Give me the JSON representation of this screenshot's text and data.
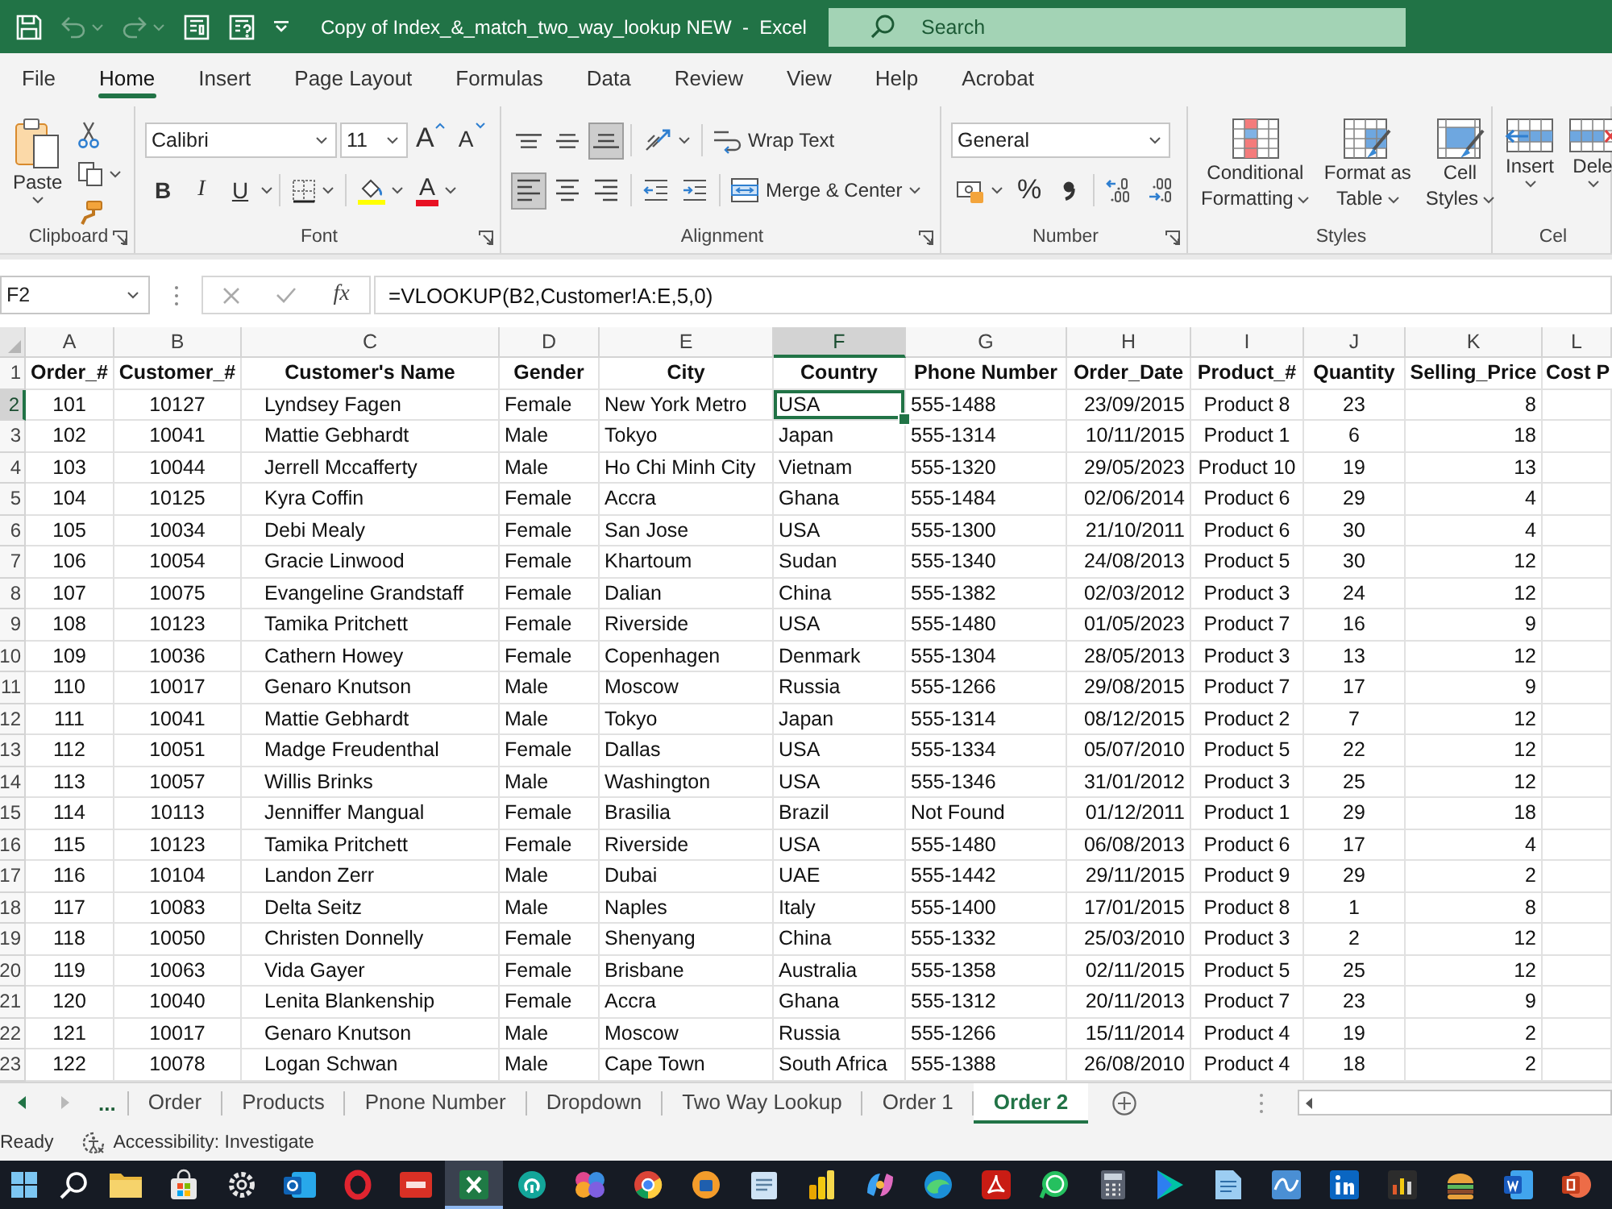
{
  "title_bar": {
    "quick_access": [
      {
        "kind": "save",
        "disabled": false
      },
      {
        "kind": "undo",
        "disabled": true
      },
      {
        "kind": "redo",
        "disabled": true
      },
      {
        "kind": "form",
        "disabled": false
      },
      {
        "kind": "form_help",
        "disabled": false
      },
      {
        "kind": "customize",
        "disabled": false
      }
    ],
    "title": "Copy of Index_&_match_two_way_lookup NEW  -  Excel",
    "search": {
      "placeholder": "Search"
    }
  },
  "menu_tabs": [
    {
      "label": "File",
      "selected": false
    },
    {
      "label": "Home",
      "selected": true
    },
    {
      "label": "Insert",
      "selected": false
    },
    {
      "label": "Page Layout",
      "selected": false
    },
    {
      "label": "Formulas",
      "selected": false
    },
    {
      "label": "Data",
      "selected": false
    },
    {
      "label": "Review",
      "selected": false
    },
    {
      "label": "View",
      "selected": false
    },
    {
      "label": "Help",
      "selected": false
    },
    {
      "label": "Acrobat",
      "selected": false
    }
  ],
  "ribbon": {
    "clipboard": {
      "paste_label": "Paste",
      "group_label": "Clipboard"
    },
    "font": {
      "name": "Calibri",
      "size": "11",
      "grow_label": "A",
      "shrink_label": "A",
      "styles": [
        {
          "kind": "bold",
          "label": "B"
        },
        {
          "kind": "italic",
          "label": "I"
        },
        {
          "kind": "underline",
          "label": "U"
        }
      ],
      "color_label": "A",
      "group_label": "Font"
    },
    "alignment": {
      "vertical": [
        {
          "kind": "top",
          "selected": false
        },
        {
          "kind": "middle",
          "selected": false
        },
        {
          "kind": "bottom",
          "selected": true
        }
      ],
      "horizontal": [
        {
          "kind": "left",
          "selected": true
        },
        {
          "kind": "center",
          "selected": false
        },
        {
          "kind": "right",
          "selected": false
        }
      ],
      "wrap_label": "Wrap Text",
      "merge_label": "Merge & Center",
      "group_label": "Alignment"
    },
    "number": {
      "format": "General",
      "percent_label": "%",
      "group_label": "Number"
    },
    "styles": {
      "buttons": [
        {
          "kind": "conditional",
          "lines": [
            "Conditional",
            "Formatting"
          ]
        },
        {
          "kind": "table",
          "lines": [
            "Format as",
            "Table"
          ]
        },
        {
          "kind": "cell",
          "lines": [
            "Cell",
            "Styles"
          ]
        }
      ],
      "group_label": "Styles"
    },
    "cells": {
      "buttons": [
        {
          "kind": "insert",
          "label": "Insert"
        },
        {
          "kind": "delete",
          "label": "Dele"
        }
      ],
      "group_label": "Cel"
    }
  },
  "formula_bar": {
    "name_box": "F2",
    "function_label": "fx",
    "formula": "=VLOOKUP(B2,Customer!A:E,5,0)"
  },
  "sheet": {
    "columns": [
      {
        "letter": "A",
        "heading": "Order_#",
        "selected": false
      },
      {
        "letter": "B",
        "heading": "Customer_#",
        "selected": false
      },
      {
        "letter": "C",
        "heading": "Customer's Name",
        "selected": false
      },
      {
        "letter": "D",
        "heading": "Gender",
        "selected": false
      },
      {
        "letter": "E",
        "heading": "City",
        "selected": false
      },
      {
        "letter": "F",
        "heading": "Country",
        "selected": true
      },
      {
        "letter": "G",
        "heading": "Phone Number",
        "selected": false
      },
      {
        "letter": "H",
        "heading": "Order_Date",
        "selected": false
      },
      {
        "letter": "I",
        "heading": "Product_#",
        "selected": false
      },
      {
        "letter": "J",
        "heading": "Quantity",
        "selected": false
      },
      {
        "letter": "K",
        "heading": "Selling_Price",
        "selected": false
      },
      {
        "letter": "L",
        "heading": "Cost P",
        "selected": false
      }
    ],
    "header_row": {
      "number": "1",
      "selected": false
    },
    "rows": [
      {
        "number": "2",
        "selected": true,
        "cells": [
          "101",
          "10127",
          "Lyndsey Fagen",
          "Female",
          "New York Metro",
          "USA",
          "555-1488",
          "23/09/2015",
          "Product 8",
          "23",
          "8"
        ]
      },
      {
        "number": "3",
        "selected": false,
        "cells": [
          "102",
          "10041",
          "Mattie Gebhardt",
          "Male",
          "Tokyo",
          "Japan",
          "555-1314",
          "10/11/2015",
          "Product 1",
          "6",
          "18"
        ]
      },
      {
        "number": "4",
        "selected": false,
        "cells": [
          "103",
          "10044",
          "Jerrell Mccafferty",
          "Male",
          "Ho Chi Minh City",
          "Vietnam",
          "555-1320",
          "29/05/2023",
          "Product 10",
          "19",
          "13"
        ]
      },
      {
        "number": "5",
        "selected": false,
        "cells": [
          "104",
          "10125",
          "Kyra Coffin",
          "Female",
          "Accra",
          "Ghana",
          "555-1484",
          "02/06/2014",
          "Product 6",
          "29",
          "4"
        ]
      },
      {
        "number": "6",
        "selected": false,
        "cells": [
          "105",
          "10034",
          "Debi Mealy",
          "Female",
          "San Jose",
          "USA",
          "555-1300",
          "21/10/2011",
          "Product 6",
          "30",
          "4"
        ]
      },
      {
        "number": "7",
        "selected": false,
        "cells": [
          "106",
          "10054",
          "Gracie Linwood",
          "Female",
          "Khartoum",
          "Sudan",
          "555-1340",
          "24/08/2013",
          "Product 5",
          "30",
          "12"
        ]
      },
      {
        "number": "8",
        "selected": false,
        "cells": [
          "107",
          "10075",
          "Evangeline Grandstaff",
          "Female",
          "Dalian",
          "China",
          "555-1382",
          "02/03/2012",
          "Product 3",
          "24",
          "12"
        ]
      },
      {
        "number": "9",
        "selected": false,
        "cells": [
          "108",
          "10123",
          "Tamika Pritchett",
          "Female",
          "Riverside",
          "USA",
          "555-1480",
          "01/05/2023",
          "Product 7",
          "16",
          "9"
        ]
      },
      {
        "number": "10",
        "selected": false,
        "cells": [
          "109",
          "10036",
          "Cathern Howey",
          "Female",
          "Copenhagen",
          "Denmark",
          "555-1304",
          "28/05/2013",
          "Product 3",
          "13",
          "12"
        ]
      },
      {
        "number": "11",
        "selected": false,
        "cells": [
          "110",
          "10017",
          "Genaro Knutson",
          "Male",
          "Moscow",
          "Russia",
          "555-1266",
          "29/08/2015",
          "Product 7",
          "17",
          "9"
        ]
      },
      {
        "number": "12",
        "selected": false,
        "cells": [
          "111",
          "10041",
          "Mattie Gebhardt",
          "Male",
          "Tokyo",
          "Japan",
          "555-1314",
          "08/12/2015",
          "Product 2",
          "7",
          "12"
        ]
      },
      {
        "number": "13",
        "selected": false,
        "cells": [
          "112",
          "10051",
          "Madge Freudenthal",
          "Female",
          "Dallas",
          "USA",
          "555-1334",
          "05/07/2010",
          "Product 5",
          "22",
          "12"
        ]
      },
      {
        "number": "14",
        "selected": false,
        "cells": [
          "113",
          "10057",
          "Willis Brinks",
          "Male",
          "Washington",
          "USA",
          "555-1346",
          "31/01/2012",
          "Product 3",
          "25",
          "12"
        ]
      },
      {
        "number": "15",
        "selected": false,
        "cells": [
          "114",
          "10113",
          "Jenniffer Mangual",
          "Female",
          "Brasilia",
          "Brazil",
          "Not Found",
          "01/12/2011",
          "Product 1",
          "29",
          "18"
        ]
      },
      {
        "number": "16",
        "selected": false,
        "cells": [
          "115",
          "10123",
          "Tamika Pritchett",
          "Female",
          "Riverside",
          "USA",
          "555-1480",
          "06/08/2013",
          "Product 6",
          "17",
          "4"
        ]
      },
      {
        "number": "17",
        "selected": false,
        "cells": [
          "116",
          "10104",
          "Landon Zerr",
          "Male",
          "Dubai",
          "UAE",
          "555-1442",
          "29/11/2015",
          "Product 9",
          "29",
          "2"
        ]
      },
      {
        "number": "18",
        "selected": false,
        "cells": [
          "117",
          "10083",
          "Delta Seitz",
          "Male",
          "Naples",
          "Italy",
          "555-1400",
          "17/01/2015",
          "Product 8",
          "1",
          "8"
        ]
      },
      {
        "number": "19",
        "selected": false,
        "cells": [
          "118",
          "10050",
          "Christen Donnelly",
          "Female",
          "Shenyang",
          "China",
          "555-1332",
          "25/03/2010",
          "Product 3",
          "2",
          "12"
        ]
      },
      {
        "number": "20",
        "selected": false,
        "cells": [
          "119",
          "10063",
          "Vida Gayer",
          "Female",
          "Brisbane",
          "Australia",
          "555-1358",
          "02/11/2015",
          "Product 5",
          "25",
          "12"
        ]
      },
      {
        "number": "21",
        "selected": false,
        "cells": [
          "120",
          "10040",
          "Lenita Blankenship",
          "Female",
          "Accra",
          "Ghana",
          "555-1312",
          "20/11/2013",
          "Product 7",
          "23",
          "9"
        ]
      },
      {
        "number": "22",
        "selected": false,
        "cells": [
          "121",
          "10017",
          "Genaro Knutson",
          "Male",
          "Moscow",
          "Russia",
          "555-1266",
          "15/11/2014",
          "Product 4",
          "19",
          "2"
        ]
      },
      {
        "number": "23",
        "selected": false,
        "cells": [
          "122",
          "10078",
          "Logan Schwan",
          "Male",
          "Cape Town",
          "South Africa",
          "555-1388",
          "26/08/2010",
          "Product 4",
          "18",
          "2"
        ]
      }
    ]
  },
  "sheet_tabs": {
    "nav": [
      {
        "kind": "previous",
        "disabled": false
      },
      {
        "kind": "next",
        "disabled": true
      }
    ],
    "overflow_label": "...",
    "tabs": [
      {
        "label": "Order",
        "selected": false
      },
      {
        "label": "Products",
        "selected": false
      },
      {
        "label": "Pnone Number",
        "selected": false
      },
      {
        "label": "Dropdown",
        "selected": false
      },
      {
        "label": "Two Way Lookup",
        "selected": false
      },
      {
        "label": "Order 1",
        "selected": false
      },
      {
        "label": "Order 2",
        "selected": true
      }
    ]
  },
  "status_bar": {
    "status": "Ready",
    "accessibility": "Accessibility: Investigate"
  },
  "taskbar": {
    "apps": [
      {
        "kind": "start",
        "selected": false
      },
      {
        "kind": "search",
        "selected": false
      },
      {
        "kind": "folder",
        "selected": false
      },
      {
        "kind": "store",
        "selected": false
      },
      {
        "kind": "settings",
        "selected": false
      },
      {
        "kind": "mail",
        "selected": false
      },
      {
        "kind": "ring",
        "selected": false
      },
      {
        "kind": "pdf",
        "selected": false
      },
      {
        "kind": "spreadsheet",
        "selected": true
      },
      {
        "kind": "swirl",
        "selected": false
      },
      {
        "kind": "clover",
        "selected": false
      },
      {
        "kind": "browser",
        "selected": false
      },
      {
        "kind": "orange",
        "selected": false
      },
      {
        "kind": "notepad",
        "selected": false
      },
      {
        "kind": "chart",
        "selected": false
      },
      {
        "kind": "petals",
        "selected": false
      },
      {
        "kind": "edge",
        "selected": false
      },
      {
        "kind": "acrobat",
        "selected": false
      },
      {
        "kind": "chat",
        "selected": false
      },
      {
        "kind": "calculator",
        "selected": false
      },
      {
        "kind": "play",
        "selected": false
      },
      {
        "kind": "page",
        "selected": false
      },
      {
        "kind": "wave",
        "selected": false
      },
      {
        "kind": "profile",
        "selected": false
      },
      {
        "kind": "bars",
        "selected": false
      },
      {
        "kind": "burger",
        "selected": false
      },
      {
        "kind": "word",
        "selected": false
      },
      {
        "kind": "slides",
        "selected": false
      }
    ]
  }
}
